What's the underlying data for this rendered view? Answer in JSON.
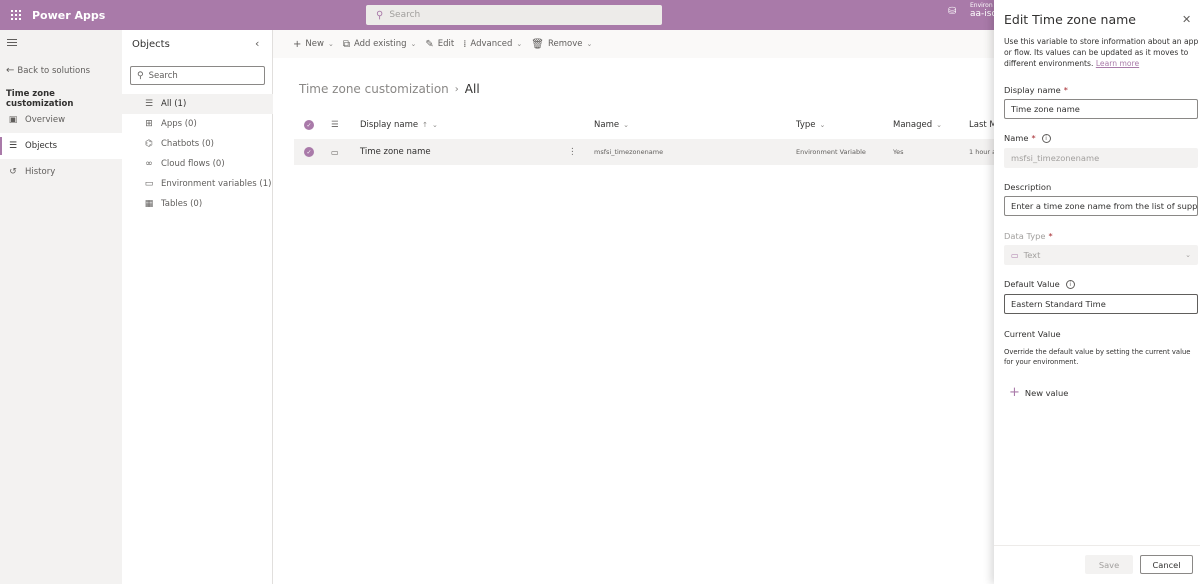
{
  "topbar": {
    "app_name": "Power Apps",
    "search_placeholder": "Search",
    "env_label": "Environ",
    "env_name": "aa-isd"
  },
  "leftnav": {
    "back_label": "Back to solutions",
    "solution_title": "Time zone customization",
    "items": [
      {
        "label": "Overview",
        "icon": "overview-icon"
      },
      {
        "label": "Objects",
        "icon": "objects-icon",
        "active": true
      },
      {
        "label": "History",
        "icon": "history-icon"
      }
    ]
  },
  "objects_pane": {
    "title": "Objects",
    "search_placeholder": "Search",
    "items": [
      {
        "label": "All  (1)",
        "icon": "list-icon",
        "active": true
      },
      {
        "label": "Apps  (0)",
        "icon": "apps-icon"
      },
      {
        "label": "Chatbots  (0)",
        "icon": "chatbot-icon"
      },
      {
        "label": "Cloud flows  (0)",
        "icon": "flow-icon"
      },
      {
        "label": "Environment variables  (1)",
        "icon": "env-variable-icon"
      },
      {
        "label": "Tables  (0)",
        "icon": "table-icon"
      }
    ]
  },
  "commandbar": {
    "new": "New",
    "add_existing": "Add existing",
    "edit": "Edit",
    "advanced": "Advanced",
    "remove": "Remove"
  },
  "main": {
    "breadcrumb_parent": "Time zone customization",
    "breadcrumb_current": "All",
    "columns": {
      "display_name": "Display name",
      "name": "Name",
      "type": "Type",
      "managed": "Managed",
      "last_modified": "Last M"
    },
    "rows": [
      {
        "display_name": "Time zone name",
        "name": "msfsi_timezonename",
        "type": "Environment Variable",
        "managed": "Yes",
        "last_modified": "1 hour a"
      }
    ]
  },
  "panel": {
    "title": "Edit Time zone name",
    "description": "Use this variable to store information about an app or flow. Its values can be updated as it moves to different environments.",
    "learn_more": "Learn more",
    "display_name_label": "Display name",
    "display_name_value": "Time zone name",
    "name_label": "Name",
    "name_value": "msfsi_timezonename",
    "description_label": "Description",
    "description_value": "Enter a time zone name from the list of supp...",
    "data_type_label": "Data Type",
    "data_type_value": "Text",
    "default_value_label": "Default Value",
    "default_value": "Eastern Standard Time",
    "current_value_label": "Current Value",
    "current_value_desc": "Override the default value by setting the current value for your environment.",
    "new_value": "New value",
    "save": "Save",
    "cancel": "Cancel",
    "required_mark": "*"
  }
}
